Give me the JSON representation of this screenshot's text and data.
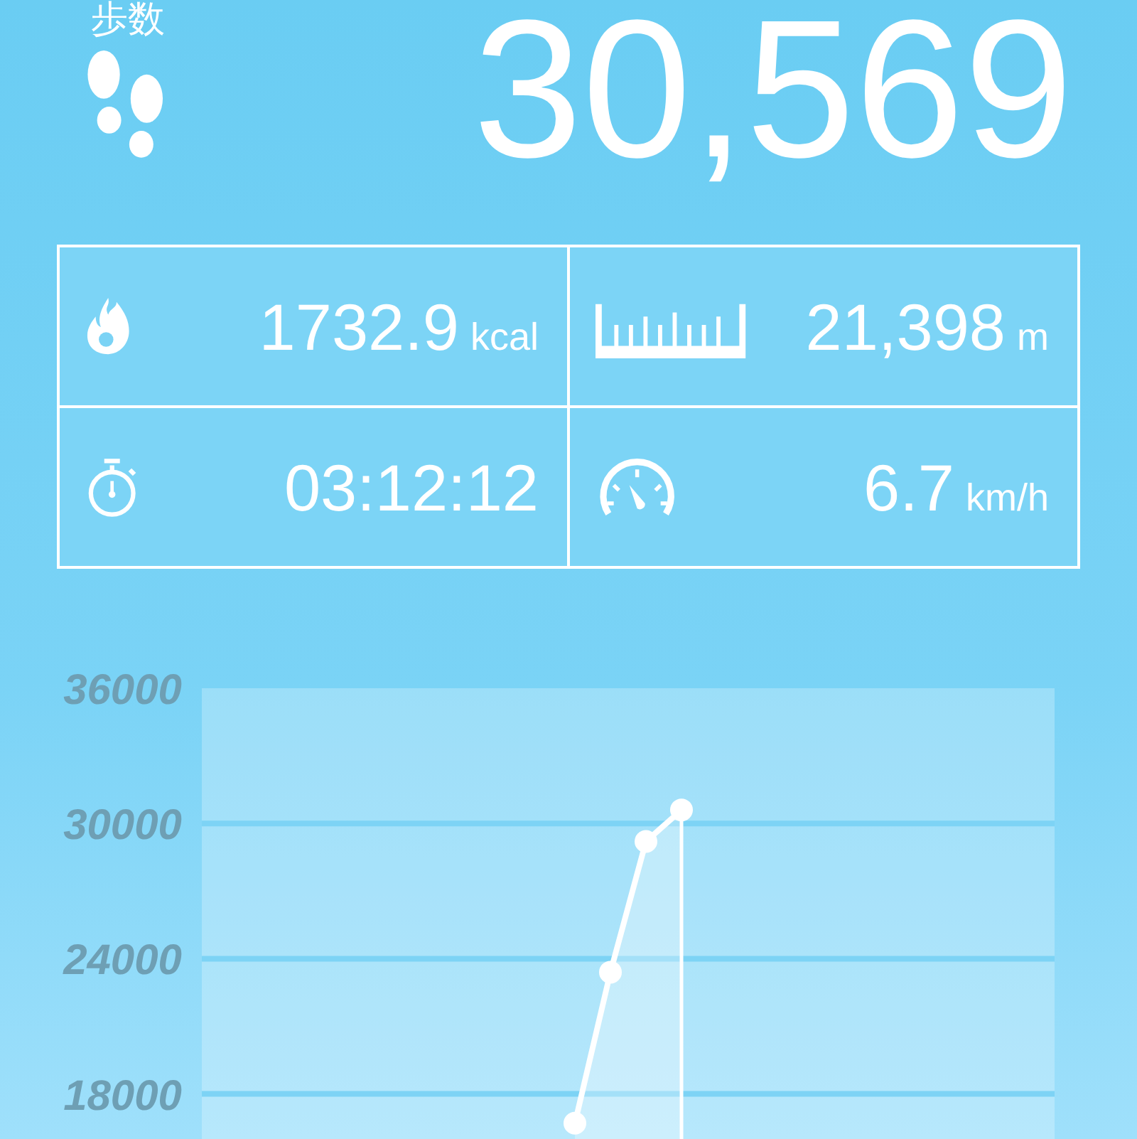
{
  "header": {
    "label": "歩数",
    "steps": "30,569"
  },
  "stats": [
    {
      "kind": "calories",
      "value": "1732.9",
      "unit": "kcal"
    },
    {
      "kind": "distance",
      "value": "21,398",
      "unit": "m"
    },
    {
      "kind": "duration",
      "value": "03:12:12"
    },
    {
      "kind": "speed",
      "value": "6.7",
      "unit": "km/h"
    }
  ],
  "chart": {
    "chart_data": {
      "type": "area",
      "categories": [
        null,
        null,
        null,
        null,
        null,
        null,
        null,
        null,
        null,
        null,
        null,
        null,
        null,
        null,
        null,
        null,
        null,
        null,
        null,
        null,
        null,
        null,
        null,
        null
      ],
      "series": [
        {
          "color": "#ffffff",
          "values": [
            null,
            null,
            null,
            null,
            null,
            null,
            null,
            null,
            null,
            null,
            16700,
            23400,
            29200,
            30600,
            null,
            null,
            null,
            null,
            null,
            null,
            null,
            null,
            null,
            null
          ]
        }
      ],
      "grid": true,
      "ylim": [
        16000,
        36000
      ],
      "yticks": [
        18000,
        24000,
        30000,
        36000
      ]
    }
  }
}
